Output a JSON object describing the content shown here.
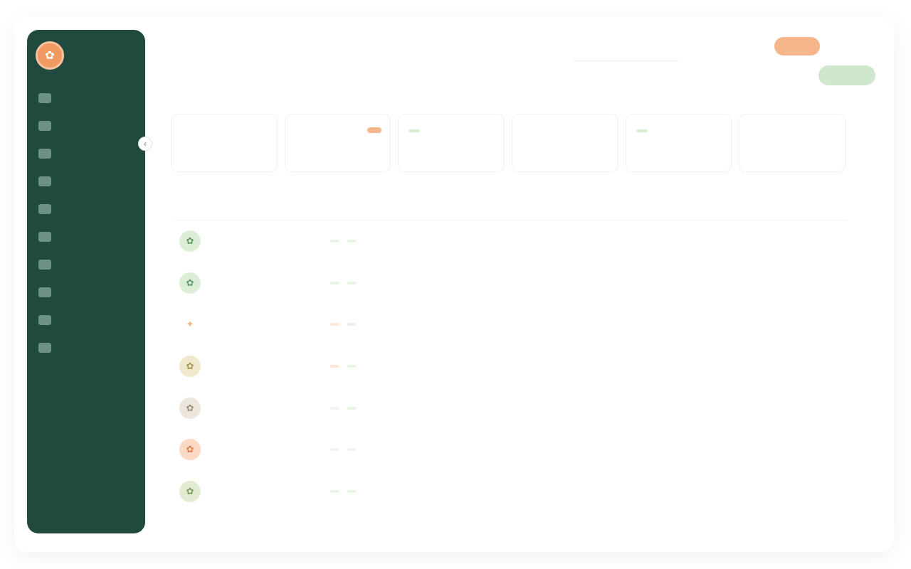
{
  "sidebar": {
    "brand": "",
    "logo_glyph": "✿",
    "items": [
      {
        "label": ""
      },
      {
        "label": ""
      },
      {
        "label": ""
      },
      {
        "label": ""
      },
      {
        "label": ""
      },
      {
        "label": ""
      },
      {
        "label": ""
      },
      {
        "label": ""
      },
      {
        "label": ""
      },
      {
        "label": ""
      }
    ],
    "collapse_glyph": "‹"
  },
  "header": {
    "title": "",
    "breadcrumb": [
      "",
      "",
      ""
    ],
    "search_placeholder": "",
    "orange_pill": "",
    "top_link": "",
    "ghost_button": "",
    "green_button": ""
  },
  "stats": [
    {
      "value": "",
      "label": ""
    },
    {
      "text": "",
      "tag": ""
    },
    {
      "tag": "",
      "label": ""
    },
    {
      "value": "",
      "label": ""
    },
    {
      "tag": "",
      "label": ""
    },
    {
      "value": "",
      "label": ""
    }
  ],
  "table": {
    "columns": [
      "",
      "",
      "",
      "",
      "",
      "",
      "",
      ""
    ],
    "rows": [
      {
        "name": "",
        "sub": "",
        "chip1": "",
        "chip2": "",
        "c3": "",
        "c4": "",
        "c6": "",
        "action": ""
      },
      {
        "name": "",
        "sub": "",
        "chip1": "",
        "chip2": "",
        "c3": "",
        "c4": "",
        "c6": "",
        "action": ""
      },
      {
        "name": "",
        "sub": "",
        "chip1": "",
        "chip2": "",
        "c3": "",
        "c4": "",
        "c6": "",
        "action": ""
      },
      {
        "name": "",
        "sub": "",
        "chip1": "",
        "chip2": "",
        "c3": "",
        "c4": "",
        "c6": "",
        "action": ""
      },
      {
        "name": "",
        "sub": "",
        "chip1": "",
        "chip2": "",
        "c3": "",
        "c4": "",
        "c6": "",
        "action": ""
      },
      {
        "name": "",
        "sub": "",
        "chip1": "",
        "chip2": "",
        "c3": "",
        "c4": "",
        "c6": "",
        "action": ""
      },
      {
        "name": "",
        "sub": "",
        "chip1": "",
        "chip2": "",
        "c3": "",
        "c4": "",
        "c6": "",
        "action": ""
      }
    ]
  },
  "colors": {
    "sidebar_bg": "#214a3e",
    "accent_orange": "#f09a62",
    "accent_green": "#cfe7cc"
  }
}
